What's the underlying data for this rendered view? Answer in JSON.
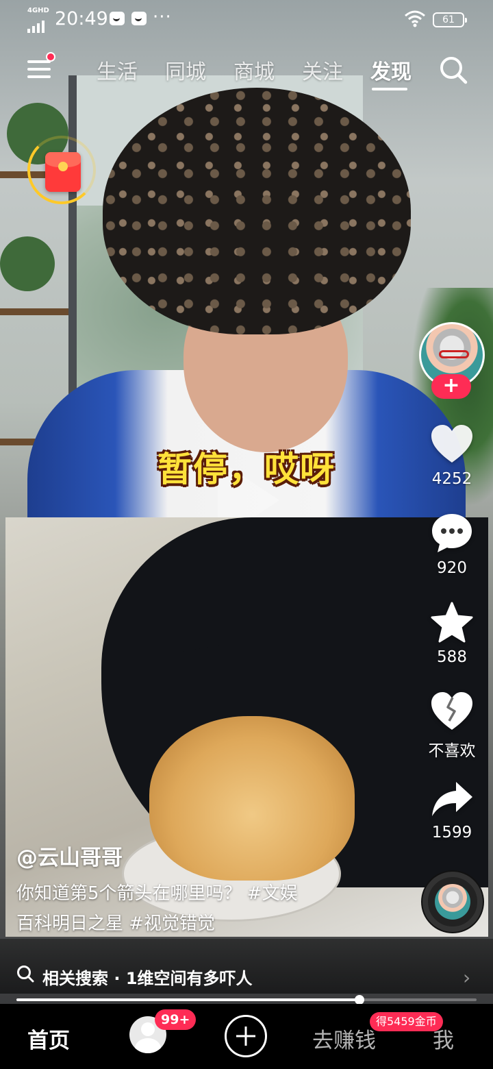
{
  "status_bar": {
    "network": "4GHD",
    "time": "20:49",
    "more": "···",
    "battery": "61"
  },
  "top_nav": {
    "tabs": [
      {
        "label": "生活",
        "active": false
      },
      {
        "label": "同城",
        "active": false
      },
      {
        "label": "商城",
        "active": false
      },
      {
        "label": "关注",
        "active": false
      },
      {
        "label": "发现",
        "active": true
      }
    ],
    "menu_icon": "menu-icon",
    "search_icon": "search-icon"
  },
  "video": {
    "caption_overlay": "暂停，哎呀",
    "author": "@云山哥哥",
    "description_line1": "你知道第5个箭头在哪里吗？ #文娱",
    "description_line2": "百科明日之星 #视觉错觉"
  },
  "actions": {
    "follow": "+",
    "like_count": "4252",
    "comment_count": "920",
    "favorite_count": "588",
    "dislike_label": "不喜欢",
    "share_count": "1599"
  },
  "related_search": {
    "label": "相关搜索 · 1维空间有多吓人",
    "arrow": "›"
  },
  "progress": 0.745,
  "bottom_bar": {
    "home": "首页",
    "friends_badge": "99+",
    "earn": "去赚钱",
    "coin_badge": "得5459金币",
    "me": "我"
  },
  "colors": {
    "accent": "#fe2c55",
    "caption_yellow": "#ffe23a",
    "red_packet_ring": "#ffc928"
  }
}
